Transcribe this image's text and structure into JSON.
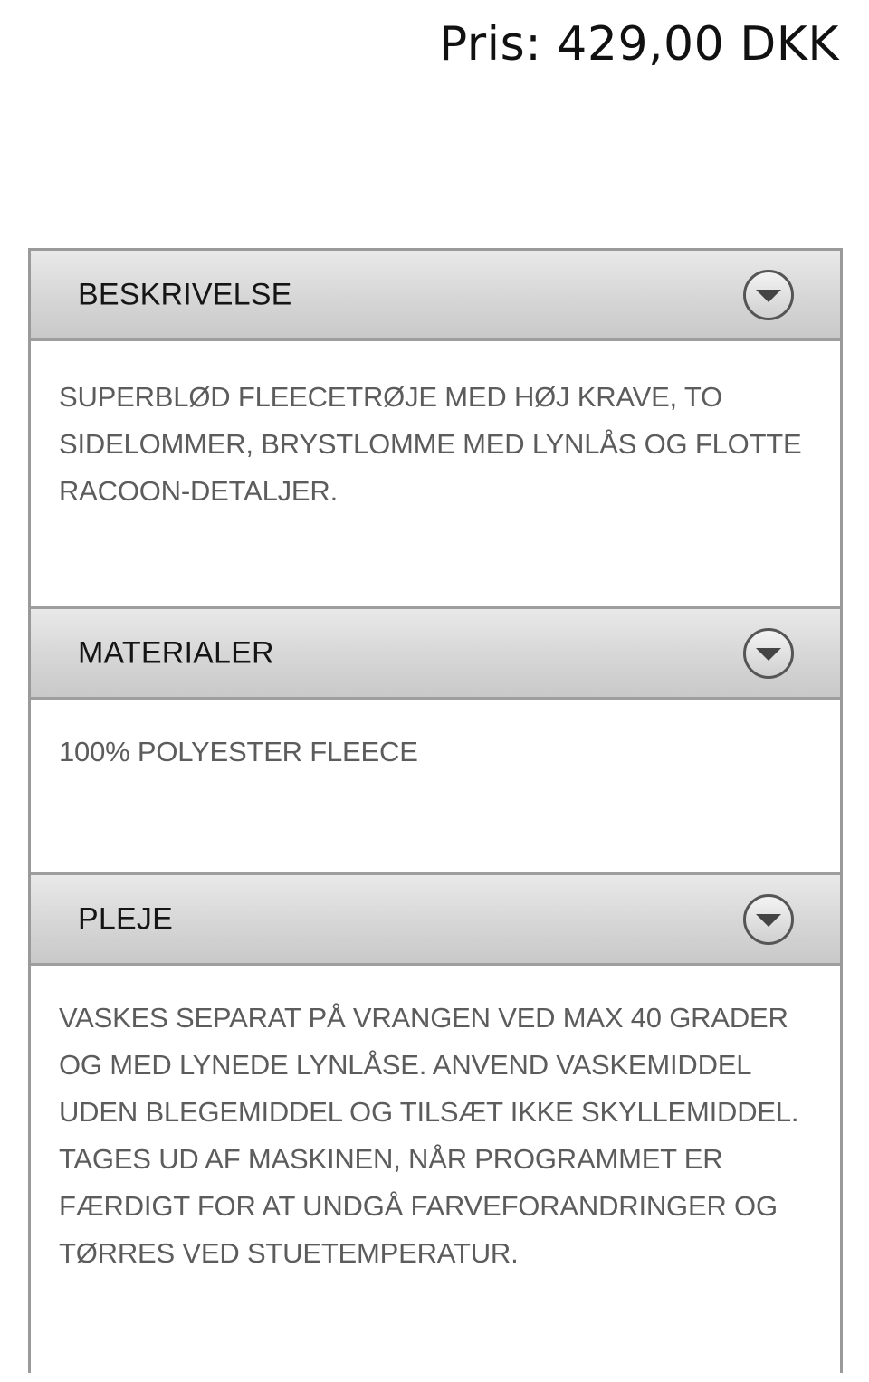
{
  "price": {
    "text": "Pris: 429,00 DKK"
  },
  "accordion": {
    "sections": [
      {
        "title": "BESKRIVELSE",
        "icon": "chevron-down-circle-icon",
        "content": "SUPERBLØD FLEECETRØJE MED HØJ KRAVE, TO SIDELOMMER, BRYSTLOMME MED LYNLÅS OG FLOTTE RACOON-DETALJER."
      },
      {
        "title": "MATERIALER",
        "icon": "chevron-down-circle-icon",
        "content": "100% POLYESTER FLEECE"
      },
      {
        "title": "PLEJE",
        "icon": "chevron-down-circle-icon",
        "content": "VASKES SEPARAT PÅ VRANGEN VED MAX 40 GRADER OG MED LYNEDE LYNLÅSE. ANVEND VASKEMIDDEL UDEN BLEGEMIDDEL OG TILSÆT IKKE SKYLLEMIDDEL. TAGES UD AF MASKINEN, NÅR PROGRAMMET ER FÆRDIGT FOR AT UNDGÅ FARVEFORANDRINGER OG TØRRES VED STUETEMPERATUR."
      }
    ]
  },
  "colors": {
    "header_gradient_top": "#e9e9e9",
    "header_gradient_bottom": "#c9c9c9",
    "border": "#9e9e9e",
    "body_text": "#5c5c5c",
    "title_text": "#151515"
  }
}
